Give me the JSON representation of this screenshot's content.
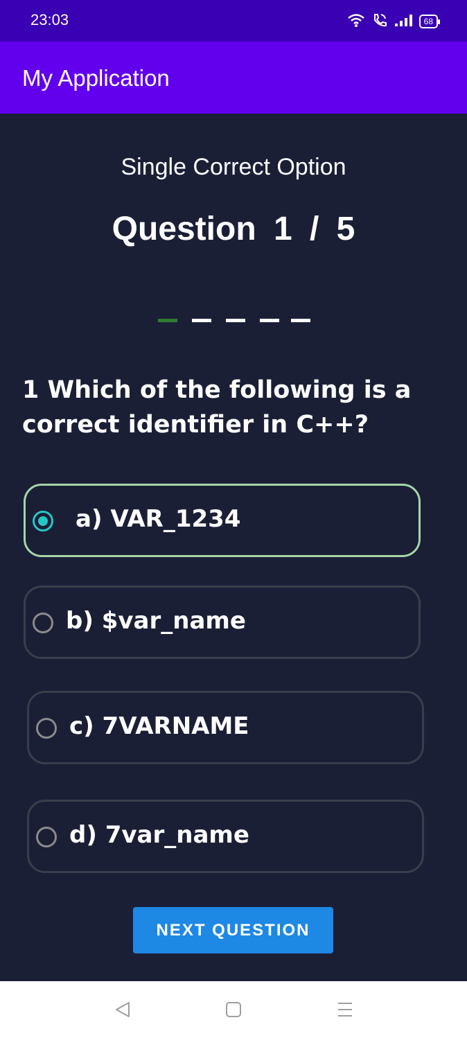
{
  "status_bar": {
    "time": "23:03",
    "battery": "68",
    "icons": [
      "wifi-icon",
      "wifi-calling-icon",
      "signal-icon",
      "battery-icon"
    ]
  },
  "app_bar": {
    "title": "My Application"
  },
  "quiz": {
    "subtitle": "Single Correct Option",
    "counter": "Question  1 / 5",
    "progress": {
      "current": 1,
      "total": 5
    },
    "question": "1 Which of the following is a correct identifier in C++?",
    "options": [
      {
        "label": "a) VAR_1234",
        "selected": true
      },
      {
        "label": "b) $var_name",
        "selected": false
      },
      {
        "label": "c) 7VARNAME",
        "selected": false
      },
      {
        "label": "d) 7var_name",
        "selected": false
      }
    ],
    "next_button": "NEXT QUESTION"
  },
  "nav_bar": {
    "icons": [
      "back-icon",
      "home-icon",
      "menu-icon"
    ]
  },
  "colors": {
    "background": "#1b1f36",
    "status_bar": "#3a00b3",
    "app_bar": "#6200ee",
    "selected_border": "#a5d6a7",
    "radio_selected": "#26c6c6",
    "button": "#1e88e5",
    "progress_done": "#2e7d32"
  }
}
